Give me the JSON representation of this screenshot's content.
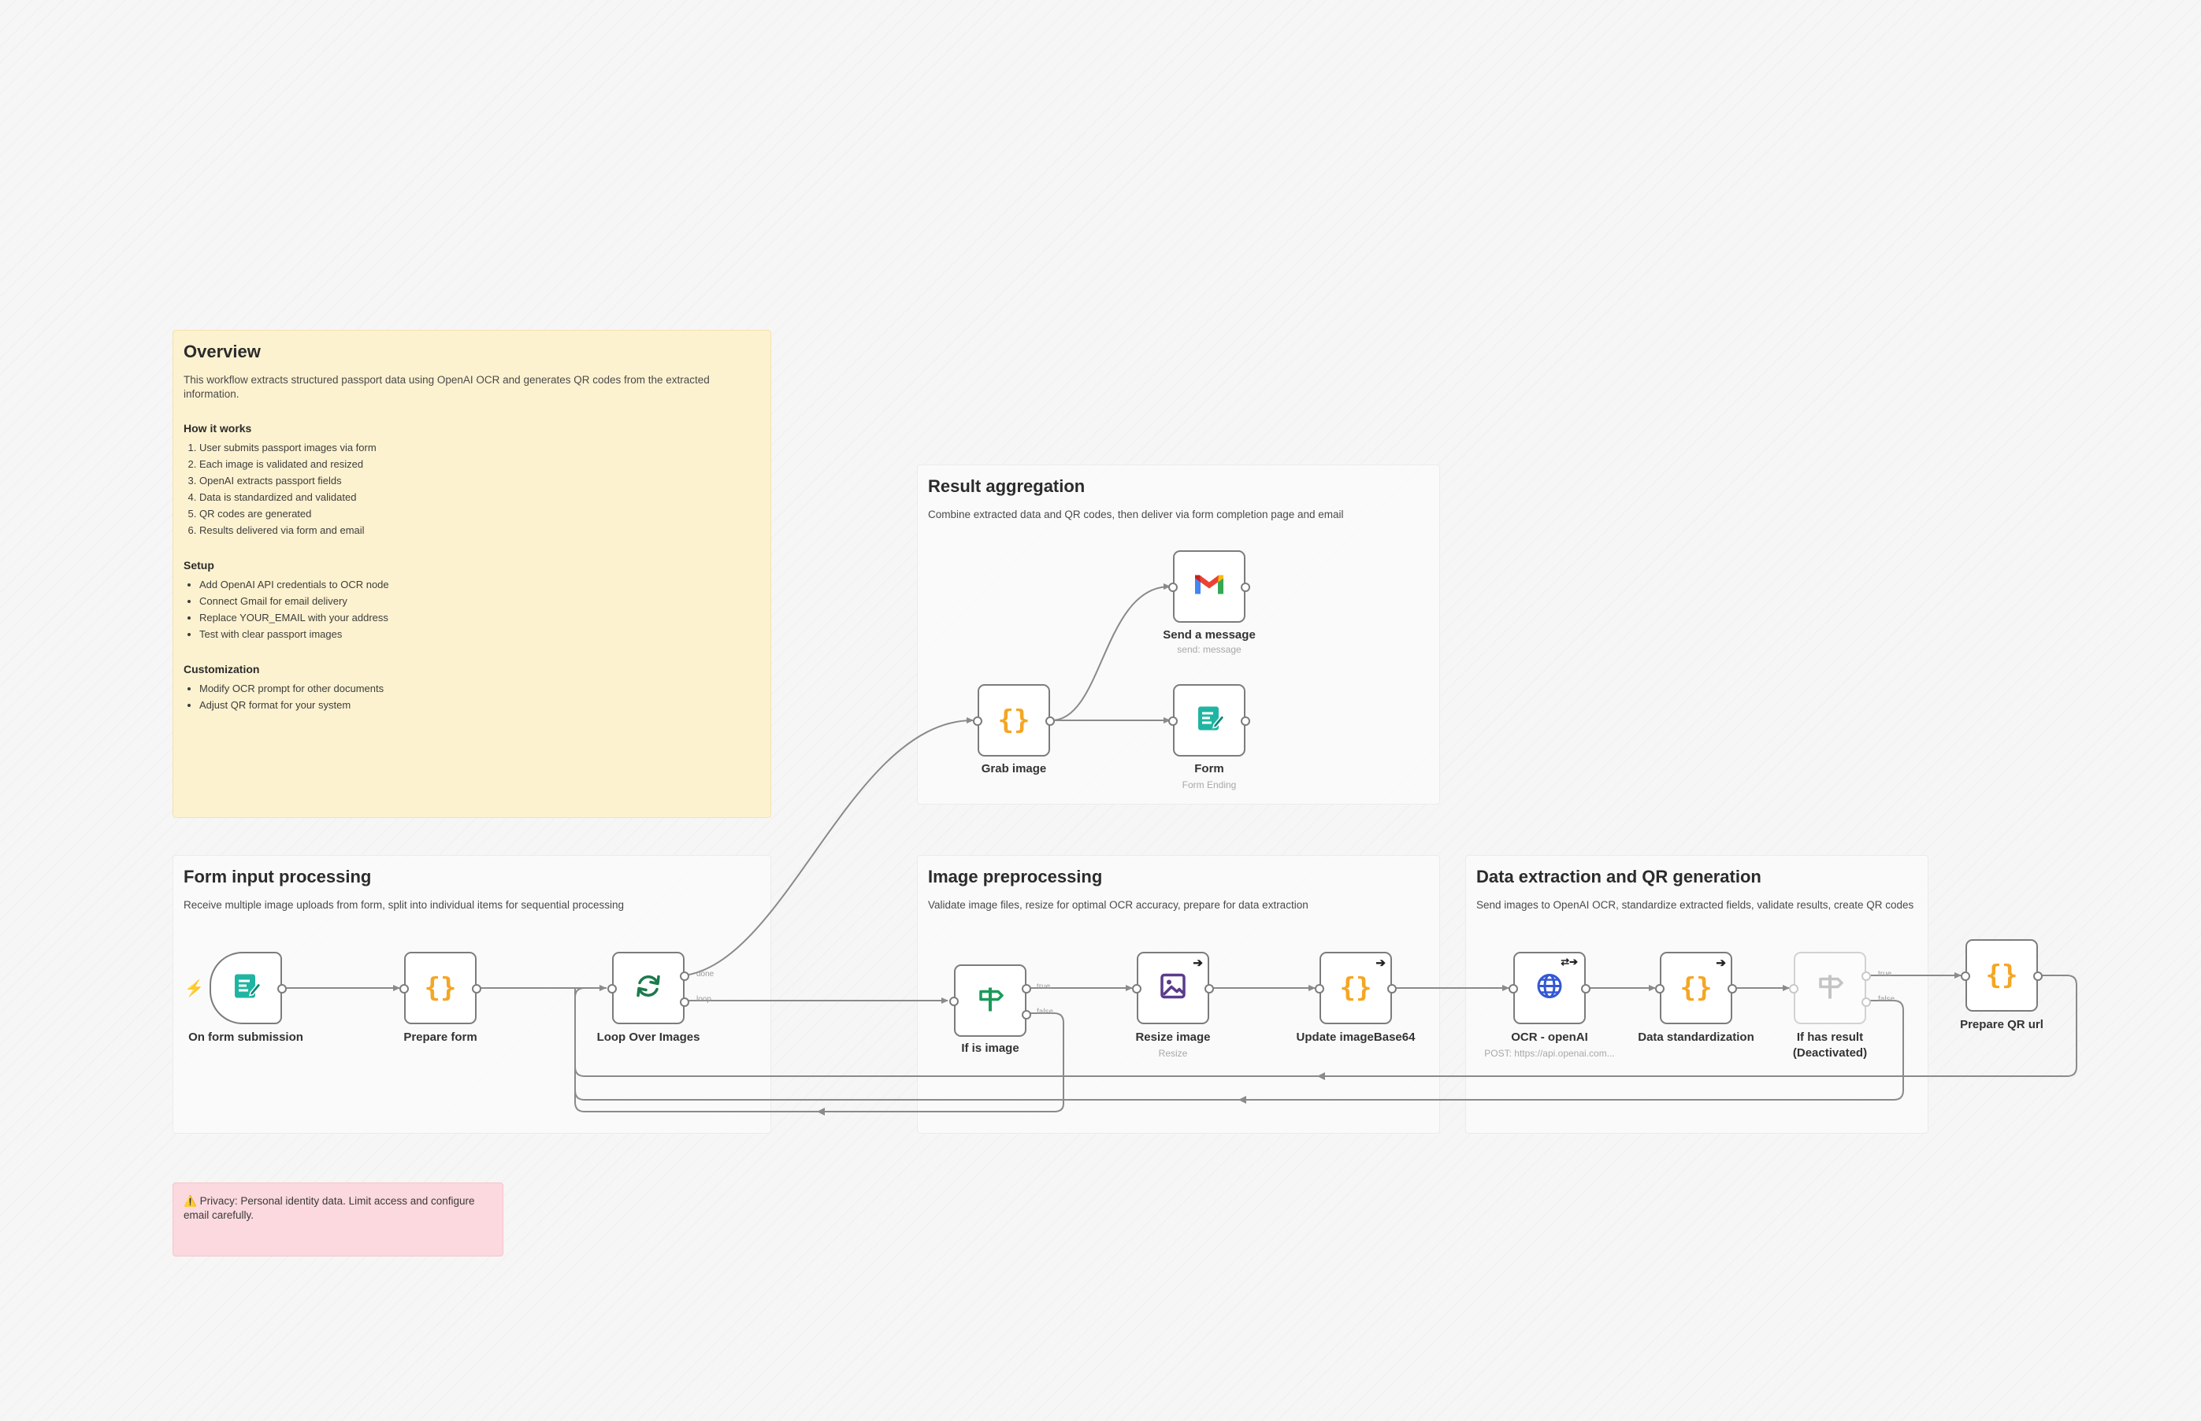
{
  "overview": {
    "title": "Overview",
    "desc": "This workflow extracts structured passport data using OpenAI OCR and generates QR codes from the extracted information.",
    "how_title": "How it works",
    "how_items": [
      "User submits passport images via form",
      "Each image is validated and resized",
      "OpenAI extracts passport fields",
      "Data is standardized and validated",
      "QR codes are generated",
      "Results delivered via form and email"
    ],
    "setup_title": "Setup",
    "setup_items": [
      "Add OpenAI API credentials to OCR node",
      "Connect Gmail for email delivery",
      "Replace YOUR_EMAIL with your address",
      "Test with clear passport images"
    ],
    "custom_title": "Customization",
    "custom_items": [
      "Modify OCR prompt for other documents",
      "Adjust QR format for your system"
    ]
  },
  "groups": {
    "result": {
      "title": "Result aggregation",
      "desc": "Combine extracted data and QR codes, then deliver via form completion page and email"
    },
    "form": {
      "title": "Form input processing",
      "desc": "Receive multiple image uploads from form, split into individual items for sequential processing"
    },
    "image": {
      "title": "Image preprocessing",
      "desc": "Validate image files, resize for optimal OCR accuracy, prepare for data extraction"
    },
    "extract": {
      "title": "Data extraction and QR generation",
      "desc": "Send images to OpenAI OCR, standardize extracted fields, validate results, create QR codes"
    }
  },
  "privacy": {
    "icon": "⚠️",
    "text": "Privacy: Personal identity data. Limit access and configure email carefully."
  },
  "nodes": {
    "form_trigger": {
      "label": "On form submission"
    },
    "prepare_form": {
      "label": "Prepare form"
    },
    "loop": {
      "label": "Loop Over Images",
      "out_done": "done",
      "out_loop": "loop"
    },
    "if_image": {
      "label": "If is image",
      "out_true": "true",
      "out_false": "false"
    },
    "resize": {
      "label": "Resize image",
      "sub": "Resize"
    },
    "update_b64": {
      "label": "Update imageBase64"
    },
    "ocr": {
      "label": "OCR - openAI",
      "sub": "POST: https://api.openai.com..."
    },
    "standardize": {
      "label": "Data standardization"
    },
    "if_result": {
      "label": "If has result\n(Deactivated)",
      "out_true": "true",
      "out_false": "false"
    },
    "prepare_qr": {
      "label": "Prepare QR url"
    },
    "grab": {
      "label": "Grab image"
    },
    "gmail": {
      "label": "Send a message",
      "sub": "send: message"
    },
    "form_end": {
      "label": "Form",
      "sub": "Form Ending"
    }
  },
  "colors": {
    "canvas": "#f6f6f6",
    "sticky": "#fdf2d0",
    "warning": "#fbd9de",
    "code_icon": "#f5a623",
    "form_icon": "#1fb5a2",
    "loop_icon": "#1b7a4c",
    "if_icon": "#1b9a5a",
    "image_icon": "#5b3a8c",
    "http_icon": "#3358d4",
    "trigger_bolt": "#ff6d5a",
    "wire": "#8a8a8a"
  }
}
